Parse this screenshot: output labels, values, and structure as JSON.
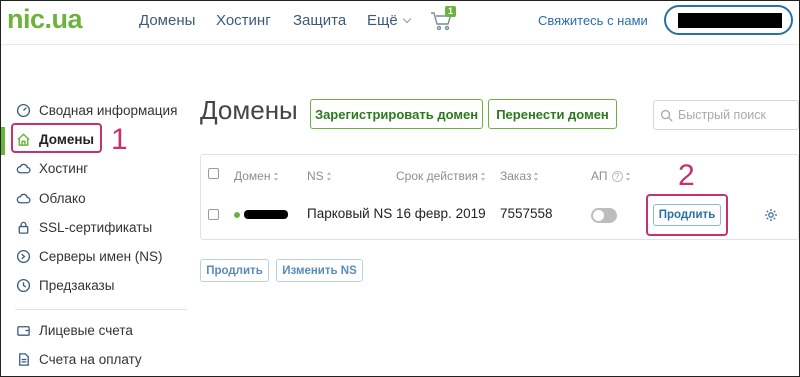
{
  "header": {
    "logo_text": "nic.ua",
    "nav": [
      "Домены",
      "Хостинг",
      "Защита",
      "Ещё"
    ],
    "cart_count": "1",
    "contact_label": "Свяжитесь с нами"
  },
  "sidebar": {
    "items": [
      {
        "label": "Сводная информация",
        "icon": "dashboard-icon"
      },
      {
        "label": "Домены",
        "icon": "home-icon"
      },
      {
        "label": "Хостинг",
        "icon": "cloud-icon"
      },
      {
        "label": "Облако",
        "icon": "cloud-icon"
      },
      {
        "label": "SSL-сертификаты",
        "icon": "lock-icon"
      },
      {
        "label": "Серверы имен (NS)",
        "icon": "dns-icon"
      },
      {
        "label": "Предзаказы",
        "icon": "clock-icon"
      },
      {
        "label": "Лицевые счета",
        "icon": "wallet-icon"
      },
      {
        "label": "Счета на оплату",
        "icon": "invoice-icon"
      }
    ]
  },
  "main": {
    "title": "Домены",
    "register_label": "Зарегистрировать домен",
    "transfer_label": "Перенести домен",
    "search_placeholder": "Быстрый поиск",
    "table": {
      "headers": [
        "Домен",
        "NS",
        "Срок действия",
        "Заказ",
        "АП"
      ],
      "rows": [
        {
          "ns": "Парковый NS",
          "expiry": "16 февр. 2019",
          "order": "7557558",
          "renew_label": "Продлить"
        }
      ]
    },
    "bulk_renew_label": "Продлить",
    "change_ns_label": "Изменить NS"
  },
  "annotations": {
    "step1": "1",
    "step2": "2"
  },
  "colors": {
    "brand_green": "#6cb33e",
    "link_blue": "#2a6fa8",
    "annotation_magenta": "#c5336e"
  }
}
